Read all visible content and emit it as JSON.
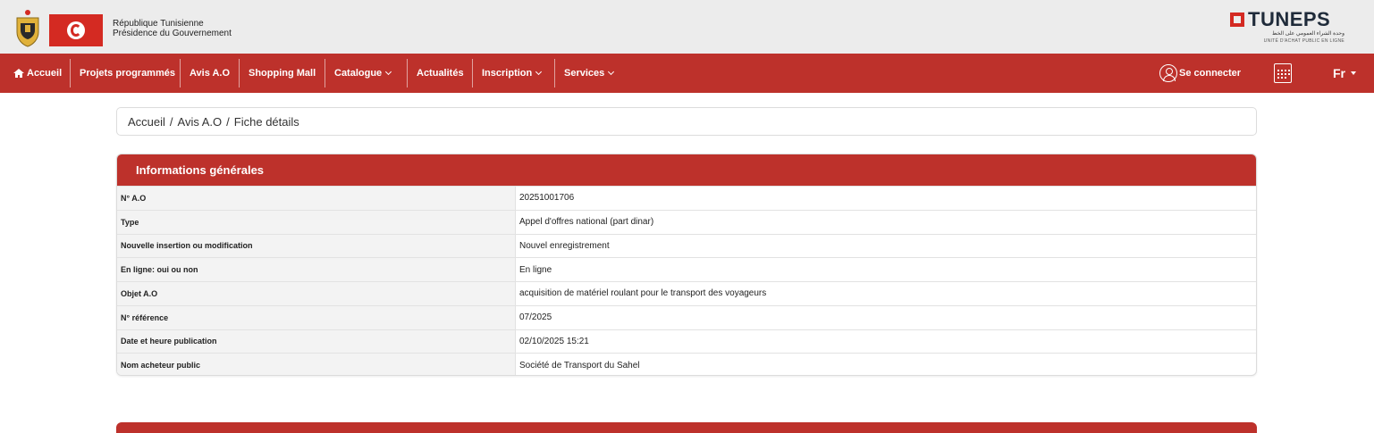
{
  "header": {
    "gov_line1": "République Tunisienne",
    "gov_line2": "Présidence du Gouvernement",
    "logo_word": "TUNEPS",
    "logo_arabic": "وحدة الشراء العمومي على الخط",
    "logo_subtitle": "UNITÉ D'ACHAT PUBLIC EN LIGNE",
    "brand_color": "#bd312b"
  },
  "nav": {
    "items": [
      {
        "label": "Accueil",
        "icon": "home-icon"
      },
      {
        "label": "Projets programmés"
      },
      {
        "label": "Avis A.O"
      },
      {
        "label": "Shopping Mall"
      },
      {
        "label": "Catalogue",
        "dropdown": true
      },
      {
        "label": "Actualités"
      },
      {
        "label": "Inscription",
        "dropdown": true
      },
      {
        "label": "Services",
        "dropdown": true
      }
    ],
    "login_label": "Se connecter",
    "calendar_icon": "calendar-icon",
    "language": "Fr"
  },
  "breadcrumb": {
    "items": [
      "Accueil",
      "Avis A.O",
      "Fiche détails"
    ]
  },
  "card": {
    "title": "Informations générales",
    "rows": [
      {
        "label": "N° A.O",
        "value": "20251001706"
      },
      {
        "label": "Type",
        "value": "Appel d'offres national (part dinar)"
      },
      {
        "label": "Nouvelle insertion ou modification",
        "value": "Nouvel enregistrement"
      },
      {
        "label": "En ligne: oui ou non",
        "value": "En ligne"
      },
      {
        "label": "Objet A.O",
        "value": "acquisition de matériel roulant pour le transport des voyageurs"
      },
      {
        "label": "N° référence",
        "value": "07/2025"
      },
      {
        "label": "Date et heure publication",
        "value": "02/10/2025 15:21"
      },
      {
        "label": "Nom acheteur public",
        "value": "Société de Transport du Sahel"
      }
    ]
  }
}
